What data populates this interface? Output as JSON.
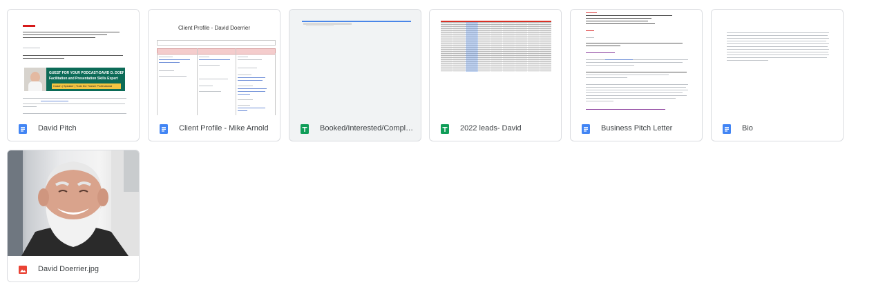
{
  "files": [
    {
      "name": "David Pitch",
      "type": "doc",
      "icon": "doc-icon"
    },
    {
      "name": "Client Profile - Mike Arnold",
      "type": "doc",
      "icon": "doc-icon"
    },
    {
      "name": "Booked/Interested/Completed",
      "type": "sheet",
      "icon": "sheet-icon",
      "selected": true
    },
    {
      "name": "2022 leads- David",
      "type": "sheet",
      "icon": "sheet-icon"
    },
    {
      "name": "Business Pitch Letter",
      "type": "doc",
      "icon": "doc-icon"
    },
    {
      "name": "Bio",
      "type": "doc",
      "icon": "doc-icon"
    },
    {
      "name": "David Doerrier.jpg",
      "type": "image",
      "icon": "image-icon"
    }
  ],
  "previews": {
    "client_profile_heading": "Client Profile - David Doerrier",
    "pitch_banner_line1": "GUEST FOR YOUR PODCAST-DAVID D. DOERRIER",
    "pitch_banner_line2": "Facilitation and Presentation Skills Expert",
    "pitch_banner_line3": "Coach | Speaker | Train the Trainer Professional"
  },
  "colors": {
    "doc_blue": "#4285f4",
    "sheet_green": "#0f9d58",
    "image_red": "#ea4335",
    "border": "#dadce0",
    "text": "#3c4043"
  }
}
